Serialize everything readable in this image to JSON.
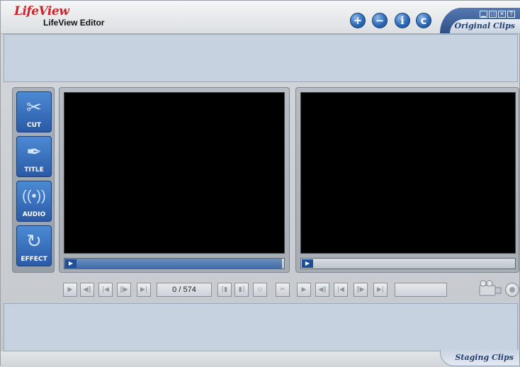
{
  "app": {
    "logo": "LifeView",
    "title": "LifeView Editor"
  },
  "header_buttons": {
    "add": "+",
    "remove": "−",
    "info": "i",
    "copyright": "c"
  },
  "window_controls": [
    "minimize",
    "restore",
    "close",
    "help"
  ],
  "tabs": {
    "original_clips": "Original Clips",
    "staging_clips": "Staging Clips"
  },
  "tools": [
    {
      "label": "CUT",
      "icon": "scissors-icon"
    },
    {
      "label": "TITLE",
      "icon": "pen-nib-icon"
    },
    {
      "label": "AUDIO",
      "icon": "sound-waves-icon"
    },
    {
      "label": "EFFECT",
      "icon": "swirl-icon"
    }
  ],
  "left_player": {
    "frame_counter": "0 / 574",
    "scrub_progress": 0.99
  },
  "right_player": {
    "scrub_progress": 0.0
  },
  "colors": {
    "accent_blue": "#2e6bb8",
    "clips_panel": "#c7d2e0",
    "logo_red": "#c8242a"
  }
}
